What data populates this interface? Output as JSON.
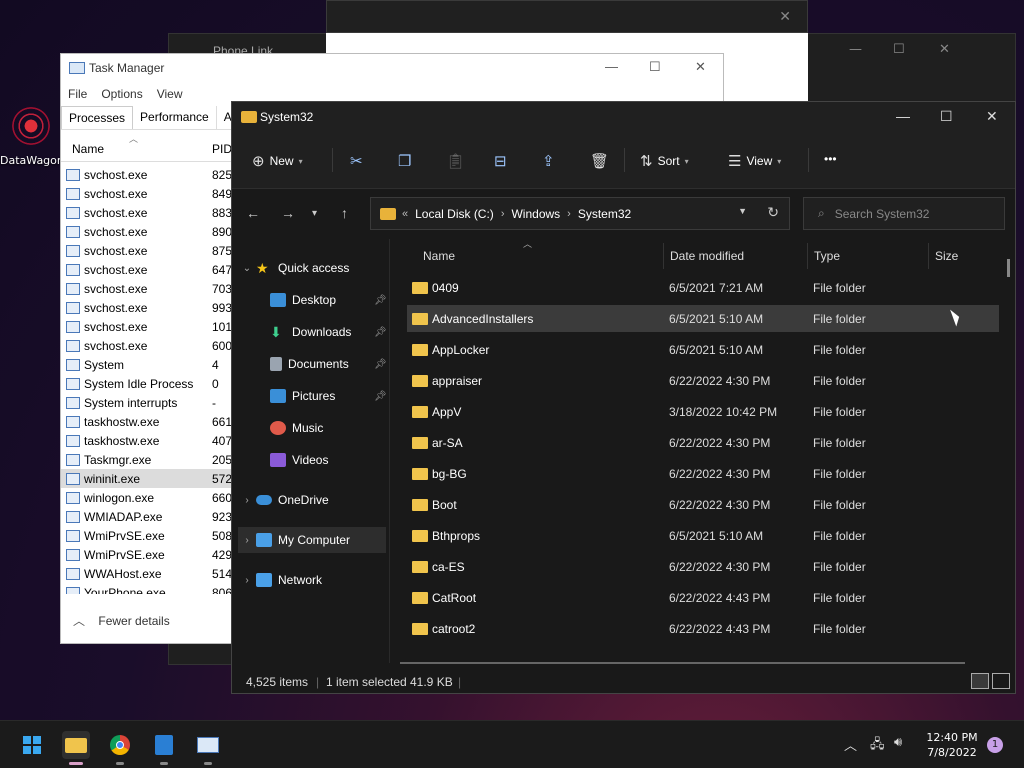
{
  "desktop": {
    "icon_label": "DataWagon"
  },
  "background_windows": {
    "phone_link_title": "Phone Link"
  },
  "task_manager": {
    "title": "Task Manager",
    "menu": [
      "File",
      "Options",
      "View"
    ],
    "tabs": [
      "Processes",
      "Performance",
      "App"
    ],
    "columns": {
      "name": "Name",
      "pid": "PID"
    },
    "rows": [
      {
        "name": "svchost.exe",
        "pid": "825"
      },
      {
        "name": "svchost.exe",
        "pid": "849"
      },
      {
        "name": "svchost.exe",
        "pid": "883"
      },
      {
        "name": "svchost.exe",
        "pid": "890"
      },
      {
        "name": "svchost.exe",
        "pid": "875"
      },
      {
        "name": "svchost.exe",
        "pid": "647"
      },
      {
        "name": "svchost.exe",
        "pid": "703"
      },
      {
        "name": "svchost.exe",
        "pid": "993"
      },
      {
        "name": "svchost.exe",
        "pid": "101"
      },
      {
        "name": "svchost.exe",
        "pid": "600"
      },
      {
        "name": "System",
        "pid": "4"
      },
      {
        "name": "System Idle Process",
        "pid": "0"
      },
      {
        "name": "System interrupts",
        "pid": "-"
      },
      {
        "name": "taskhostw.exe",
        "pid": "661"
      },
      {
        "name": "taskhostw.exe",
        "pid": "407"
      },
      {
        "name": "Taskmgr.exe",
        "pid": "205"
      },
      {
        "name": "wininit.exe",
        "pid": "572"
      },
      {
        "name": "winlogon.exe",
        "pid": "660"
      },
      {
        "name": "WMIADAP.exe",
        "pid": "923"
      },
      {
        "name": "WmiPrvSE.exe",
        "pid": "508"
      },
      {
        "name": "WmiPrvSE.exe",
        "pid": "429"
      },
      {
        "name": "WWAHost.exe",
        "pid": "514"
      },
      {
        "name": "YourPhone.exe",
        "pid": "806"
      }
    ],
    "selected_row": "wininit.exe",
    "fewer_details": "Fewer details"
  },
  "explorer": {
    "title": "System32",
    "toolbar": {
      "new": "New",
      "sort": "Sort",
      "view": "View",
      "more": "•••"
    },
    "address": {
      "prefix": "«",
      "segments": [
        "Local Disk (C:)",
        "Windows",
        "System32"
      ]
    },
    "search_placeholder": "Search System32",
    "nav": {
      "quick_access": "Quick access",
      "desktop": "Desktop",
      "downloads": "Downloads",
      "documents": "Documents",
      "pictures": "Pictures",
      "music": "Music",
      "videos": "Videos",
      "onedrive": "OneDrive",
      "my_computer": "My Computer",
      "network": "Network"
    },
    "columns": {
      "name": "Name",
      "date": "Date modified",
      "type": "Type",
      "size": "Size"
    },
    "files": [
      {
        "name": "0409",
        "date": "6/5/2021 7:21 AM",
        "type": "File folder"
      },
      {
        "name": "AdvancedInstallers",
        "date": "6/5/2021 5:10 AM",
        "type": "File folder"
      },
      {
        "name": "AppLocker",
        "date": "6/5/2021 5:10 AM",
        "type": "File folder"
      },
      {
        "name": "appraiser",
        "date": "6/22/2022 4:30 PM",
        "type": "File folder"
      },
      {
        "name": "AppV",
        "date": "3/18/2022 10:42 PM",
        "type": "File folder"
      },
      {
        "name": "ar-SA",
        "date": "6/22/2022 4:30 PM",
        "type": "File folder"
      },
      {
        "name": "bg-BG",
        "date": "6/22/2022 4:30 PM",
        "type": "File folder"
      },
      {
        "name": "Boot",
        "date": "6/22/2022 4:30 PM",
        "type": "File folder"
      },
      {
        "name": "Bthprops",
        "date": "6/5/2021 5:10 AM",
        "type": "File folder"
      },
      {
        "name": "ca-ES",
        "date": "6/22/2022 4:30 PM",
        "type": "File folder"
      },
      {
        "name": "CatRoot",
        "date": "6/22/2022 4:43 PM",
        "type": "File folder"
      },
      {
        "name": "catroot2",
        "date": "6/22/2022 4:43 PM",
        "type": "File folder"
      }
    ],
    "selected_file": "AdvancedInstallers",
    "status": {
      "items": "4,525 items",
      "selected": "1 item selected",
      "size": "41.9 KB"
    }
  },
  "taskbar": {
    "time": "12:40 PM",
    "date": "7/8/2022",
    "notifications": "1"
  }
}
